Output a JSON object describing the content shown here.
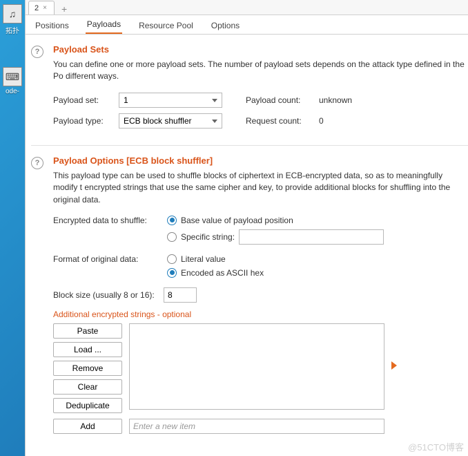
{
  "desktop": {
    "icons": [
      {
        "name": "launcher-icon",
        "glyph": "♫",
        "label": "拓扑"
      },
      {
        "name": "code-icon",
        "glyph": "⌨",
        "label": "ode-"
      }
    ]
  },
  "file_tabs": {
    "active": "2",
    "close_glyph": "×",
    "add_glyph": "+"
  },
  "section_tabs": {
    "items": [
      "Positions",
      "Payloads",
      "Resource Pool",
      "Options"
    ],
    "active_index": 1
  },
  "payload_sets": {
    "title": "Payload Sets",
    "desc": "You can define one or more payload sets. The number of payload sets depends on the attack type defined in the Po different ways.",
    "set_label": "Payload set:",
    "set_value": "1",
    "type_label": "Payload type:",
    "type_value": "ECB block shuffler",
    "count_label": "Payload count:",
    "count_value": "unknown",
    "req_label": "Request count:",
    "req_value": "0"
  },
  "payload_options": {
    "title": "Payload Options [ECB block shuffler]",
    "desc": "This payload type can be used to shuffle blocks of ciphertext in ECB-encrypted data, so as to meaningfully modify t encrypted strings that use the same cipher and key, to provide additional blocks for shuffling into the original data.",
    "encrypted_label": "Encrypted data to shuffle:",
    "radio_base": "Base value of payload position",
    "radio_specific": "Specific string:",
    "specific_value": "",
    "format_label": "Format of original data:",
    "radio_literal": "Literal value",
    "radio_ascii": "Encoded as ASCII hex",
    "block_label": "Block size (usually 8 or 16):",
    "block_value": "8",
    "additional_label": "Additional encrypted strings - optional",
    "buttons": {
      "paste": "Paste",
      "load": "Load ...",
      "remove": "Remove",
      "clear": "Clear",
      "dedup": "Deduplicate",
      "add": "Add"
    },
    "add_placeholder": "Enter a new item"
  },
  "watermark": "@51CTO博客"
}
